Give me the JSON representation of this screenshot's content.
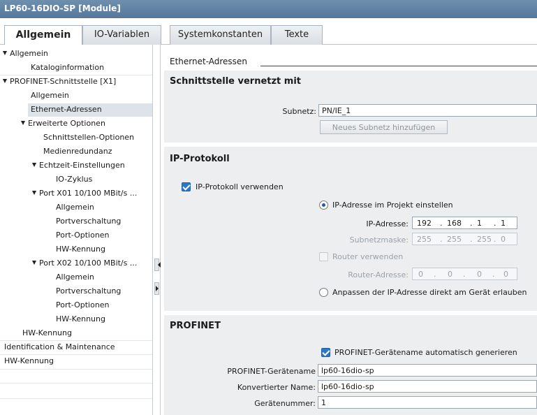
{
  "window": {
    "title": "LP60-16DIO-SP [Module]"
  },
  "tabs": [
    "Allgemein",
    "IO-Variablen",
    "Systemkonstanten",
    "Texte"
  ],
  "tree": [
    {
      "label": "Allgemein",
      "expanded": true
    },
    {
      "label": "Kataloginformation"
    },
    {
      "label": "PROFINET-Schnittstelle [X1]",
      "expanded": true
    },
    {
      "label": "Allgemein"
    },
    {
      "label": "Ethernet-Adressen",
      "selected": true
    },
    {
      "label": "Erweiterte Optionen",
      "expanded": true
    },
    {
      "label": "Schnittstellen-Optionen"
    },
    {
      "label": "Medienredundanz"
    },
    {
      "label": "Echtzeit-Einstellungen",
      "expanded": true
    },
    {
      "label": "IO-Zyklus"
    },
    {
      "label": "Port X01 10/100 MBit/s ...",
      "expanded": true
    },
    {
      "label": "Allgemein"
    },
    {
      "label": "Portverschaltung"
    },
    {
      "label": "Port-Optionen"
    },
    {
      "label": "HW-Kennung"
    },
    {
      "label": "Port X02 10/100 MBit/s ...",
      "expanded": true
    },
    {
      "label": "Allgemein"
    },
    {
      "label": "Portverschaltung"
    },
    {
      "label": "Port-Optionen"
    },
    {
      "label": "HW-Kennung"
    },
    {
      "label": "HW-Kennung"
    },
    {
      "label": "Identification & Maintenance"
    },
    {
      "label": "HW-Kennung"
    }
  ],
  "content": {
    "heading": "Ethernet-Adressen",
    "network": {
      "title": "Schnittstelle vernetzt mit",
      "subnet_label": "Subnetz:",
      "subnet_value": "PN/IE_1",
      "add_subnet_button": "Neues Subnetz hinzufügen"
    },
    "ip": {
      "title": "IP-Protokoll",
      "use_ip_label": "IP-Protokoll verwenden",
      "use_ip_checked": true,
      "set_in_project_label": "IP-Adresse im Projekt einstellen",
      "ip_address_label": "IP-Adresse:",
      "ip_address": [
        "192",
        "168",
        "1",
        "1"
      ],
      "subnet_mask_label": "Subnetzmaske:",
      "subnet_mask": [
        "255",
        "255",
        "255",
        "0"
      ],
      "use_router_label": "Router verwenden",
      "router_address_label": "Router-Adresse:",
      "router_address": [
        "0",
        "0",
        "0",
        "0"
      ],
      "set_on_device_label": "Anpassen der IP-Adresse direkt am Gerät erlauben"
    },
    "profinet": {
      "title": "PROFINET",
      "auto_name_label": "PROFINET-Gerätename automatisch generieren",
      "auto_name_checked": true,
      "device_name_label": "PROFINET-Gerätename",
      "device_name": "lp60-16dio-sp",
      "converted_name_label": "Konvertierter Name:",
      "converted_name": "lp60-16dio-sp",
      "device_number_label": "Gerätenummer:",
      "device_number": "1"
    }
  }
}
